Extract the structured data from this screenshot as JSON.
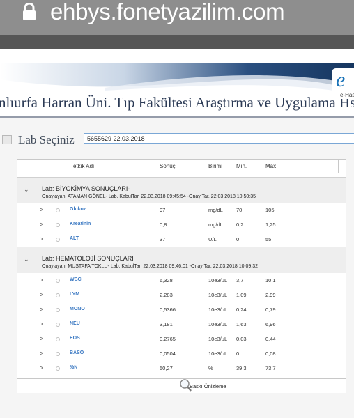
{
  "browser": {
    "url": "ehbys.fonetyazilim.com"
  },
  "banner": {
    "title": "nlıurfa Harran Üni. Tıp Fakültesi Araştırma ve Uygulama Hst.",
    "logo_text": "e-Has"
  },
  "lab_select": {
    "label": "Lab Seçiniz",
    "value": "5655629 22.03.2018"
  },
  "table": {
    "columns": [
      "Tetkik Adı",
      "Sonuç",
      "Birimi",
      "Min.",
      "Max"
    ],
    "groups": [
      {
        "title": "Lab: BİYOKİMYA SONUÇLARI-",
        "approval": "Onaylayan: ATAMAN GÖNEL- Lab. KabulTar. 22.03.2018 09:45:54 -Onay Tar. 22.03.2018 10:50:35",
        "rows": [
          {
            "name": "Glukoz",
            "result": "97",
            "unit": "mg/dL",
            "min": "70",
            "max": "105"
          },
          {
            "name": "Kreatinin",
            "result": "0,8",
            "unit": "mg/dL",
            "min": "0,2",
            "max": "1,25"
          },
          {
            "name": "ALT",
            "result": "37",
            "unit": "U/L",
            "min": "0",
            "max": "55"
          }
        ]
      },
      {
        "title": "Lab: HEMATOLOJİ SONUÇLARI",
        "approval": "Onaylayan: MUSTAFA TOKLU- Lab. KabulTar. 22.03.2018 09:46:01 -Onay Tar. 22.03.2018 10:09:32",
        "rows": [
          {
            "name": "WBC",
            "result": "6,328",
            "unit": "10e3/uL",
            "min": "3,7",
            "max": "10,1"
          },
          {
            "name": "LYM",
            "result": "2,283",
            "unit": "10e3/uL",
            "min": "1,09",
            "max": "2,99"
          },
          {
            "name": "MONO",
            "result": "0,5366",
            "unit": "10e3/uL",
            "min": "0,24",
            "max": "0,79"
          },
          {
            "name": "NEU",
            "result": "3,181",
            "unit": "10e3/uL",
            "min": "1,63",
            "max": "6,96"
          },
          {
            "name": "EOS",
            "result": "0,2765",
            "unit": "10e3/uL",
            "min": "0,03",
            "max": "0,44"
          },
          {
            "name": "BASO",
            "result": "0,0504",
            "unit": "10e3/uL",
            "min": "0",
            "max": "0,08"
          },
          {
            "name": "%N",
            "result": "50,27",
            "unit": "%",
            "min": "39,3",
            "max": "73,7"
          }
        ]
      }
    ]
  },
  "footer": {
    "print_label": "Baskı Önizleme"
  },
  "icons": {
    "lock": "lock-icon",
    "expand": "chevron-down-icon",
    "row": "chevron-right-icon",
    "print": "magnifier-print-icon"
  },
  "colors": {
    "test_name": "#3a78c2",
    "banner_dark": "#1f3f6e",
    "url_bar": "#8e8e8e"
  }
}
